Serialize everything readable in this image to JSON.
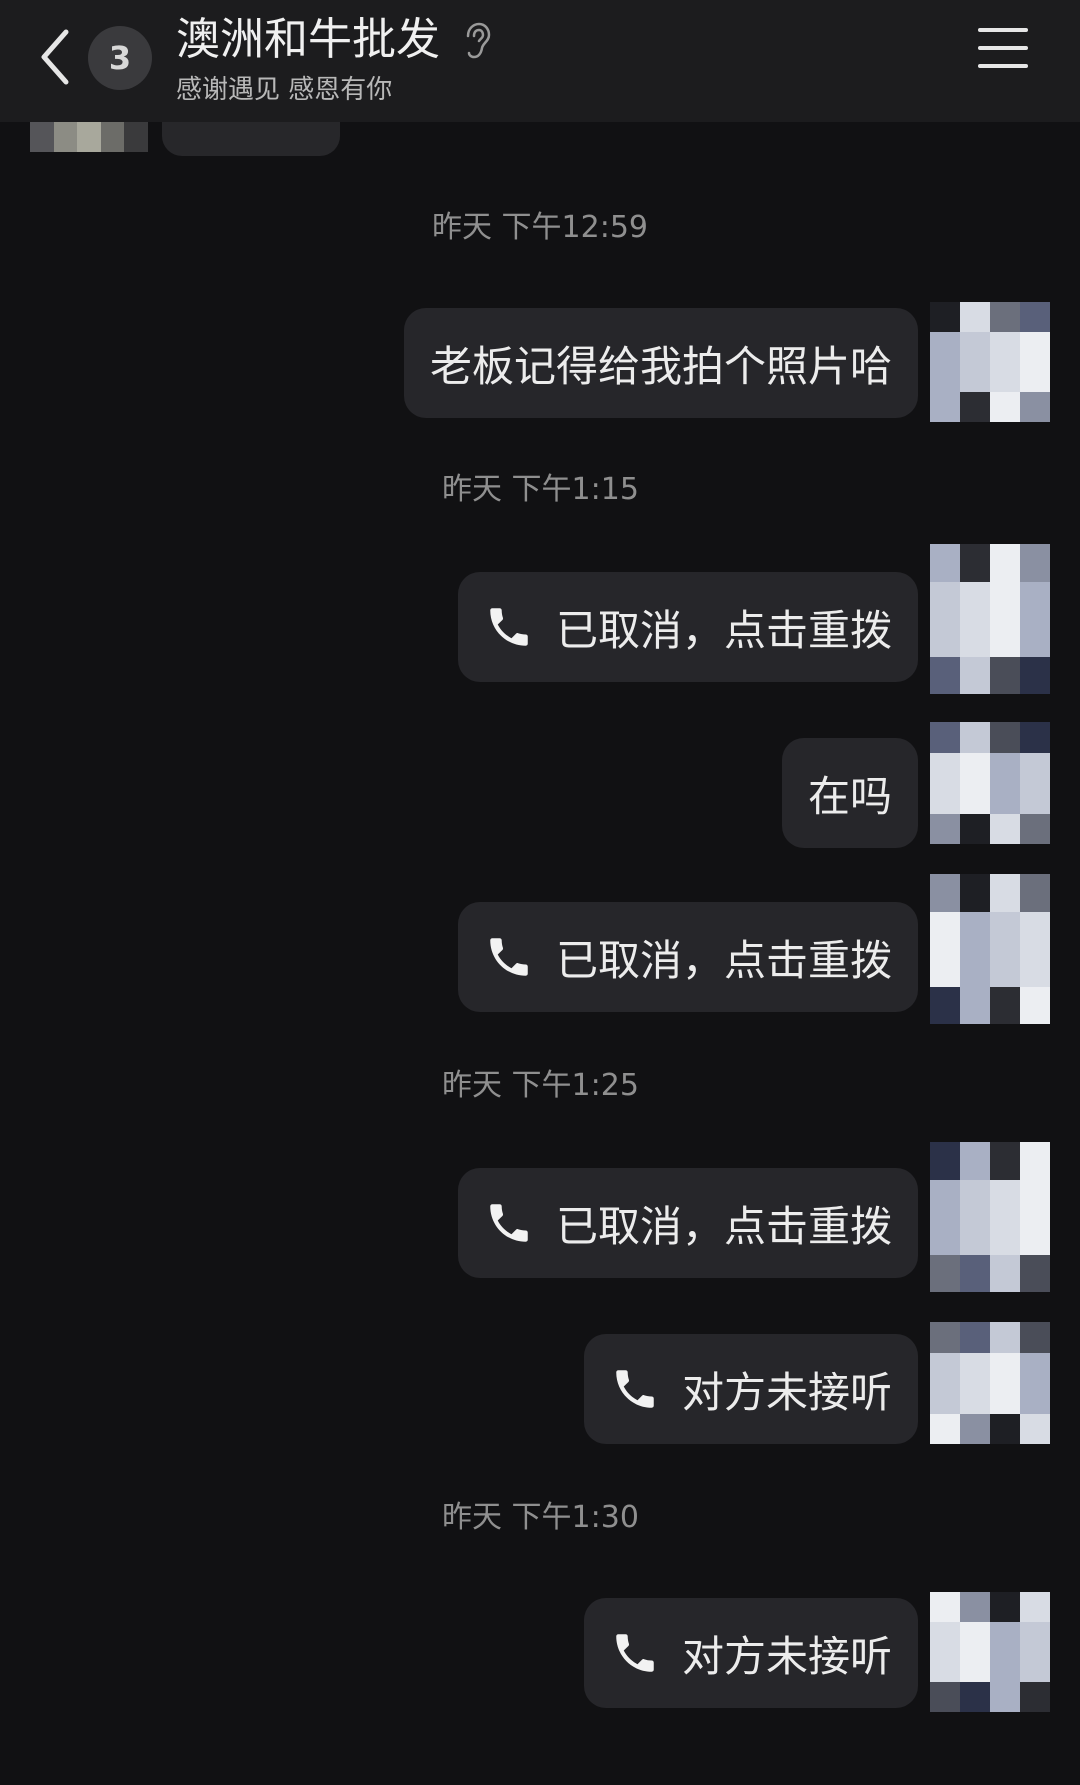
{
  "header": {
    "unread_count": "3",
    "title": "澳洲和牛批发",
    "subtitle": "感谢遇见 感恩有你"
  },
  "messages": [
    {
      "timestamp": "昨天 下午12:59"
    },
    {
      "text": "老板记得给我拍个照片哈",
      "type": "text"
    },
    {
      "timestamp": "昨天 下午1:15"
    },
    {
      "text": "已取消，点击重拨",
      "type": "call"
    },
    {
      "text": "在吗",
      "type": "text"
    },
    {
      "text": "已取消，点击重拨",
      "type": "call"
    },
    {
      "timestamp": "昨天 下午1:25"
    },
    {
      "text": "已取消，点击重拨",
      "type": "call"
    },
    {
      "text": "对方未接听",
      "type": "call"
    },
    {
      "timestamp": "昨天 下午1:30"
    },
    {
      "text": "对方未接听",
      "type": "call"
    }
  ],
  "icons": {
    "back": "chevron-left-icon",
    "ear": "ear-icon",
    "menu": "menu-icon",
    "call": "phone-icon"
  },
  "colors": {
    "background": "#111113",
    "header": "#1c1c1e",
    "bubble": "#26262a",
    "text": "#ececec",
    "timestamp": "#8f8f8f"
  }
}
